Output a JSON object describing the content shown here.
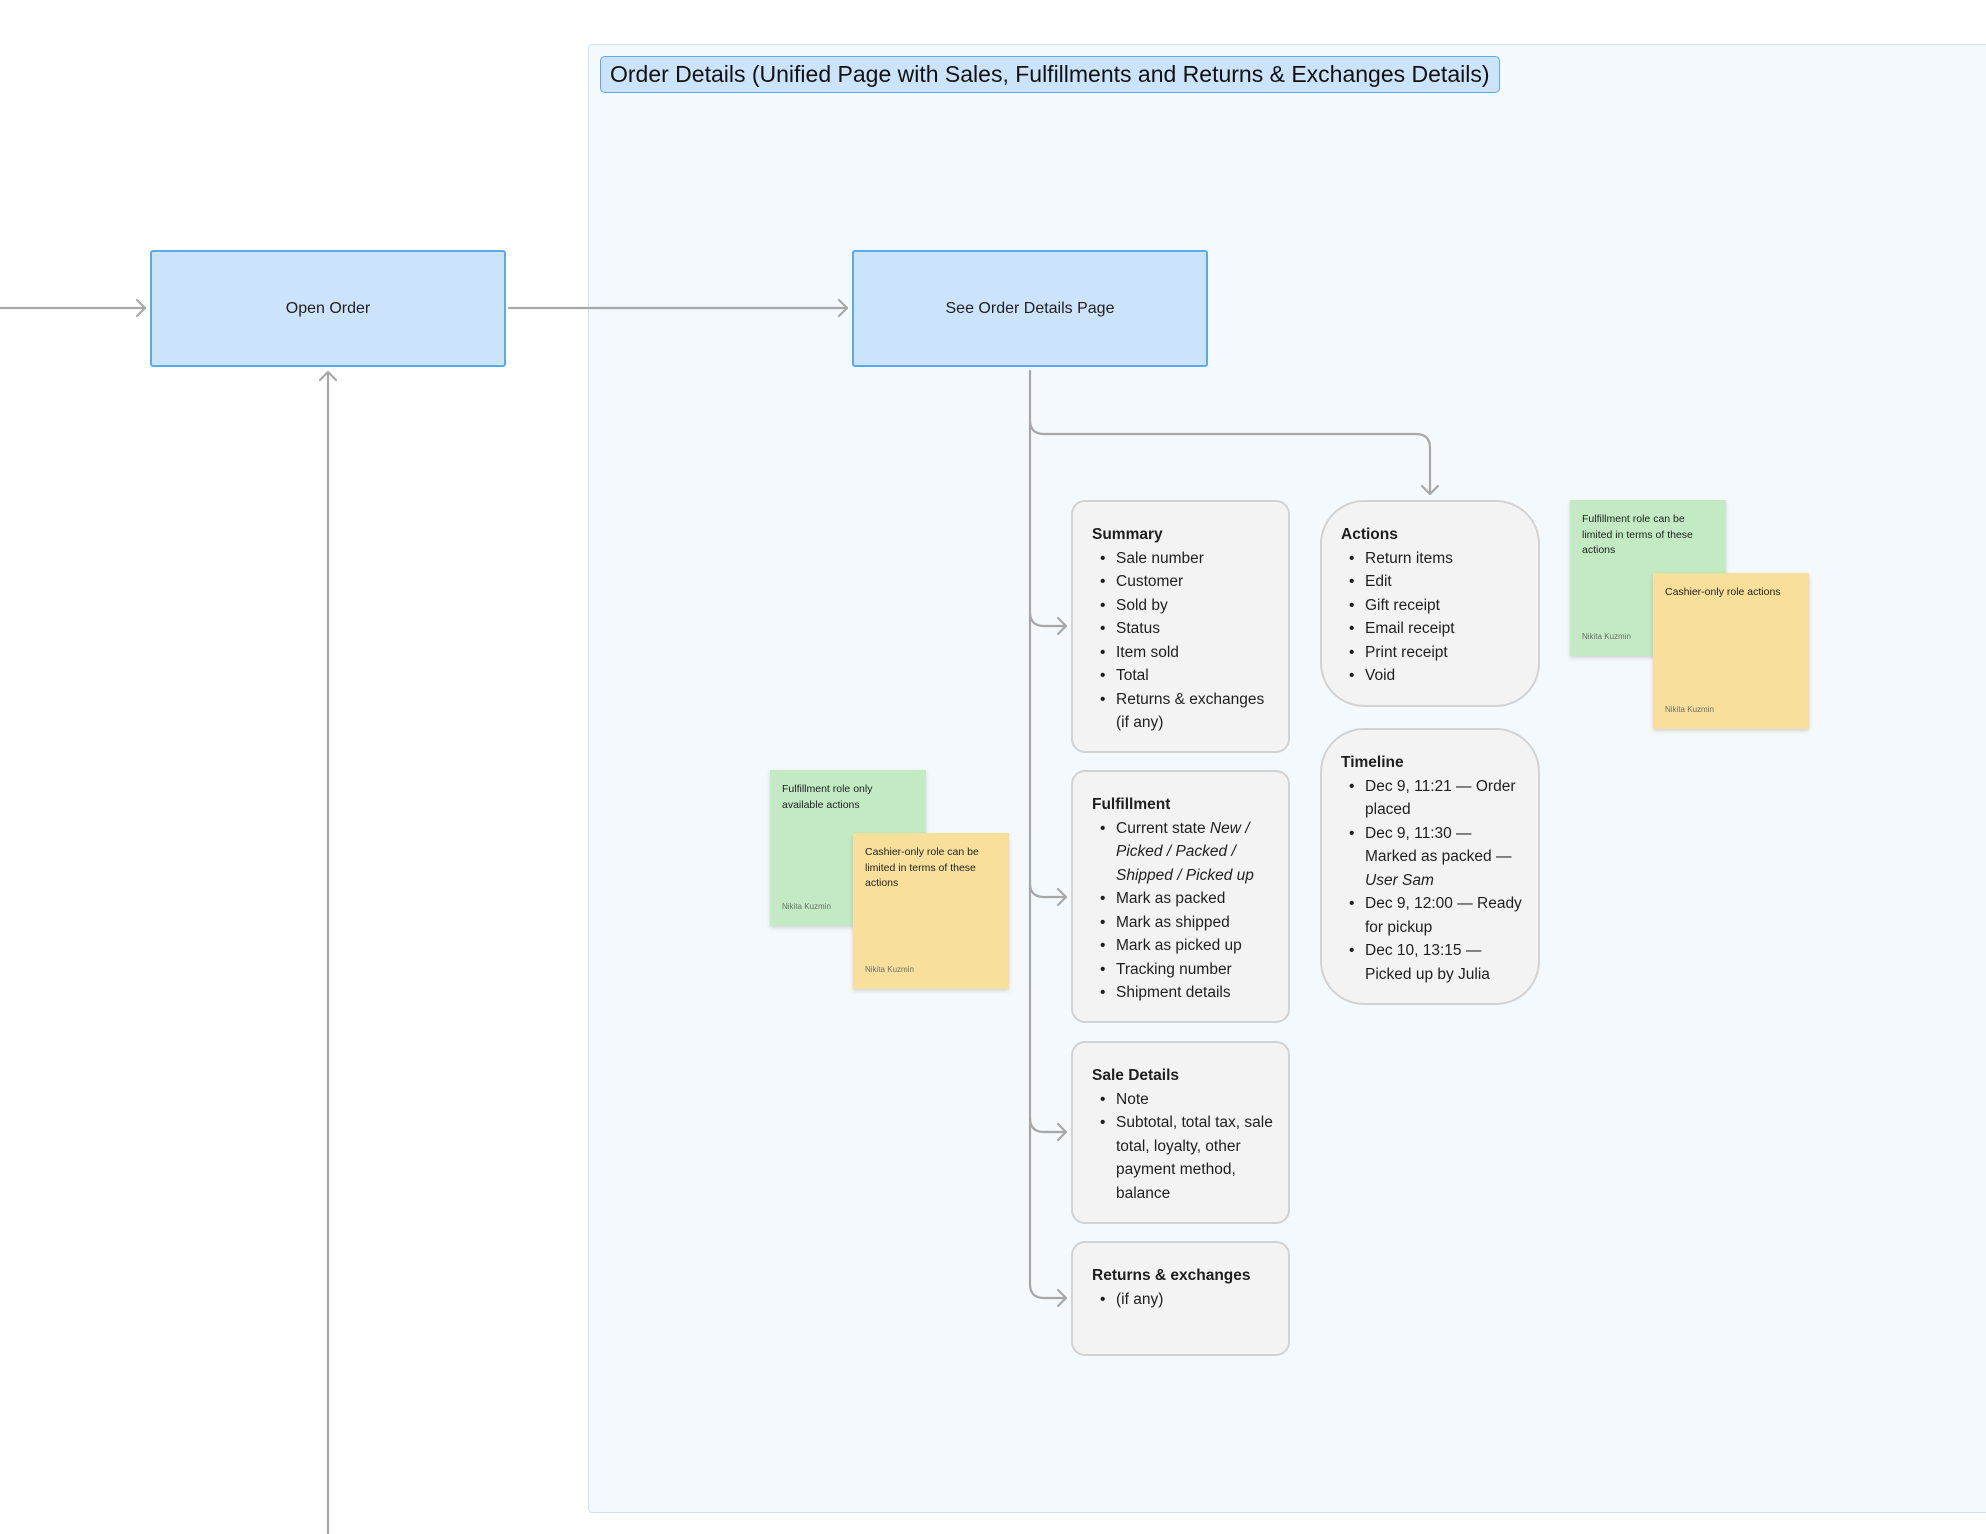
{
  "section": {
    "title": "Order Details (Unified Page with Sales, Fulfillments and Returns & Exchanges Details)"
  },
  "nodes": {
    "open_order": "Open Order",
    "see_order_details": "See Order Details Page"
  },
  "cards": {
    "summary": {
      "title": "Summary",
      "items": [
        "Sale number",
        "Customer",
        "Sold by",
        "Status",
        "Item sold",
        "Total",
        "Returns & exchanges (if any)"
      ]
    },
    "fulfillment": {
      "title": "Fulfillment",
      "current_state_prefix": "Current state ",
      "current_state_values": "New / Picked / Packed / Shipped / Picked up",
      "items": [
        "Mark as packed",
        "Mark as shipped",
        "Mark as picked up",
        "Tracking number",
        "Shipment details"
      ]
    },
    "sale_details": {
      "title": "Sale Details",
      "items": [
        "Note",
        "Subtotal, total tax, sale total, loyalty, other payment method, balance"
      ]
    },
    "returns": {
      "title": "Returns & exchanges",
      "items": [
        "(if any)"
      ]
    },
    "actions": {
      "title": "Actions",
      "items": [
        "Return items",
        "Edit",
        "Gift receipt",
        "Email receipt",
        "Print receipt",
        "Void"
      ]
    },
    "timeline": {
      "title": "Timeline",
      "items": [
        "Dec 9, 11:21 — Order placed",
        "Dec 9, 11:30 — Marked as packed",
        "Dec 9, 12:00 — Ready for pickup",
        "Dec 10, 13:15 — Picked up by Julia"
      ],
      "item2_suffix_prefix": "— ",
      "item2_suffix_user": "User Sam"
    }
  },
  "stickies": {
    "fulfillment_limited": {
      "text": "Fulfillment role can be limited in terms of these actions",
      "author": "Nikita Kuzmin",
      "color": "#c2ebc4"
    },
    "cashier_only": {
      "text": "Cashier-only role actions",
      "author": "Nikita Kuzmin",
      "color": "#f9e09a"
    },
    "fulfillment_only": {
      "text": "Fulfillment role only available actions",
      "author": "Nikita Kuzmin",
      "color": "#c2ebc4"
    },
    "cashier_limited": {
      "text": "Cashier-only role can be limited in terms of these actions",
      "author": "Nikita Kuzmin",
      "color": "#f9e09a"
    }
  },
  "colors": {
    "process_fill": "#cbe4fb",
    "process_border": "#5aa9ea",
    "section_fill": "#f4f9fe",
    "card_fill": "#f3f3f3",
    "connector": "#a7a7a7"
  }
}
